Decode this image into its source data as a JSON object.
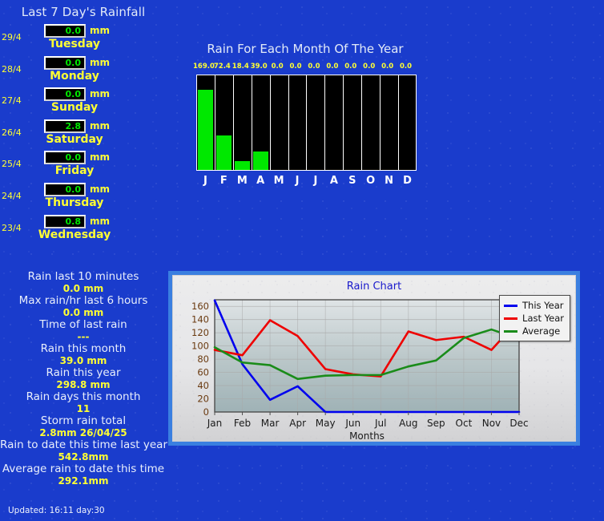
{
  "left_panel": {
    "title": "Last 7 Day's Rainfall",
    "unit": "mm",
    "days": [
      {
        "date": "29/4",
        "value": "0.0",
        "name": "Tuesday"
      },
      {
        "date": "28/4",
        "value": "0.0",
        "name": "Monday"
      },
      {
        "date": "27/4",
        "value": "0.0",
        "name": "Sunday"
      },
      {
        "date": "26/4",
        "value": "2.8",
        "name": "Saturday"
      },
      {
        "date": "25/4",
        "value": "0.0",
        "name": "Friday"
      },
      {
        "date": "24/4",
        "value": "0.0",
        "name": "Thursday"
      },
      {
        "date": "23/4",
        "value": "0.8",
        "name": "Wednesday"
      }
    ],
    "stats": [
      {
        "label": "Rain last 10 minutes",
        "value": "0.0 mm"
      },
      {
        "label": "Max rain/hr last 6 hours",
        "value": "0.0 mm"
      },
      {
        "label": "Time of last rain",
        "value": "---"
      },
      {
        "label": "Rain this month",
        "value": "39.0 mm"
      },
      {
        "label": "Rain this year",
        "value": "298.8 mm"
      },
      {
        "label": "Rain days this month",
        "value": "11"
      },
      {
        "label": "Storm rain total",
        "value": "2.8mm 26/04/25"
      },
      {
        "label": "Rain to date this time last year",
        "value": "542.8mm"
      },
      {
        "label": "Average rain to date this time",
        "value": "292.1mm"
      }
    ],
    "updated": "Updated: 16:11 day:30"
  },
  "month_chart": {
    "title": "Rain For Each Month Of The Year",
    "bar_color": "#00e800",
    "background_color": "#000000"
  },
  "rain_chart": {
    "title": "Rain Chart",
    "legend": [
      {
        "label": "This Year",
        "color": "#0000ee"
      },
      {
        "label": "Last Year",
        "color": "#ee0000"
      },
      {
        "label": "Average",
        "color": "#1a8c1a"
      }
    ]
  },
  "chart_data": [
    {
      "type": "bar",
      "title": "Rain For Each Month Of The Year",
      "categories": [
        "J",
        "F",
        "M",
        "A",
        "M",
        "J",
        "J",
        "A",
        "S",
        "O",
        "N",
        "D"
      ],
      "values": [
        169.0,
        72.4,
        18.4,
        39.0,
        0.0,
        0.0,
        0.0,
        0.0,
        0.0,
        0.0,
        0.0,
        0.0
      ],
      "value_labels": [
        "169.0",
        "72.4",
        "18.4",
        "39.0",
        "0.0",
        "0.0",
        "0.0",
        "0.0",
        "0.0",
        "0.0",
        "0.0",
        "0.0"
      ],
      "xlabel": "",
      "ylabel": "",
      "ylim": [
        0,
        200
      ],
      "grid": false,
      "legend": "none"
    },
    {
      "type": "line",
      "title": "Rain Chart",
      "categories": [
        "Jan",
        "Feb",
        "Mar",
        "Apr",
        "May",
        "Jun",
        "Jul",
        "Aug",
        "Sep",
        "Oct",
        "Nov",
        "Dec"
      ],
      "series": [
        {
          "name": "This Year",
          "color": "#0000ee",
          "values": [
            169.0,
            72.4,
            18.4,
            39.0,
            0.0,
            0.0,
            0.0,
            0.0,
            0.0,
            0.0,
            0.0,
            0.0
          ]
        },
        {
          "name": "Last Year",
          "color": "#ee0000",
          "values": [
            94,
            86,
            139,
            115,
            65,
            57,
            54,
            122,
            109,
            114,
            94,
            140
          ]
        },
        {
          "name": "Average",
          "color": "#1a8c1a",
          "values": [
            98,
            75,
            71,
            50,
            55,
            56,
            56,
            69,
            78,
            112,
            125,
            111
          ]
        }
      ],
      "xlabel": "Months",
      "ylabel": "",
      "ylim": [
        0,
        170
      ],
      "yticks": [
        0,
        20,
        40,
        60,
        80,
        100,
        120,
        140,
        160
      ],
      "grid": true,
      "legend": "top-right"
    }
  ]
}
